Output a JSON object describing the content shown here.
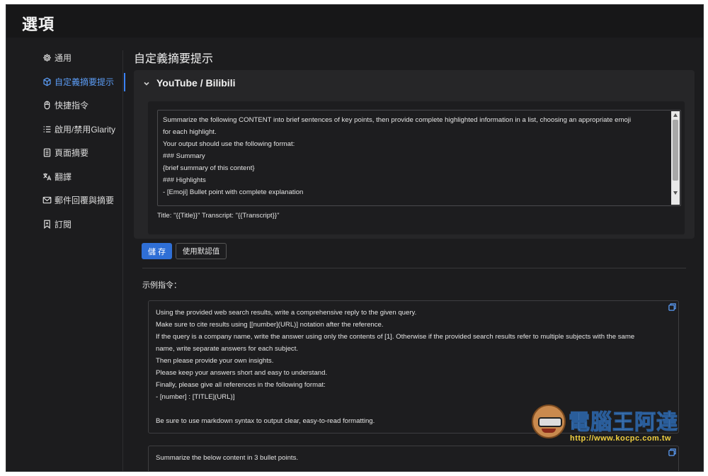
{
  "header": {
    "title": "選項"
  },
  "sidebar": {
    "items": [
      {
        "label": "通用",
        "icon": "gear-icon"
      },
      {
        "label": "自定義摘要提示",
        "icon": "cube-icon",
        "active": true
      },
      {
        "label": "快捷指令",
        "icon": "mouse-icon"
      },
      {
        "label": "啟用/禁用Glarity",
        "icon": "list-toggle-icon"
      },
      {
        "label": "頁面摘要",
        "icon": "document-icon"
      },
      {
        "label": "翻譯",
        "icon": "translate-icon"
      },
      {
        "label": "郵件回覆與摘要",
        "icon": "mail-icon"
      },
      {
        "label": "訂閱",
        "icon": "bookmark-icon"
      }
    ]
  },
  "main": {
    "section_title": "自定義摘要提示",
    "card": {
      "header": "YouTube / Bilibili",
      "prompt_lines": [
        "Summarize the following CONTENT into brief sentences of key points, then provide complete highlighted information in a list, choosing an appropriate emoji",
        "for each highlight.",
        "Your output should use the following format:",
        "### Summary",
        "{brief summary of this content}",
        "### Highlights",
        "- [Emoji] Bullet point with complete explanation"
      ],
      "tail_line": "Title: \"{{Title}}\" Transcript: \"{{Transcript}}\""
    },
    "buttons": {
      "save": "儲 存",
      "default": "使用默認值"
    },
    "examples_label": "示例指令：",
    "examples": [
      {
        "lines": [
          "Using the provided web search results, write a comprehensive reply to the given query.",
          "Make sure to cite results using [[number](URL)] notation after the reference.",
          "If the query is a company name, write the answer using only the contents of [1]. Otherwise if the provided search results refer to multiple subjects with the same",
          "name, write separate answers for each subject.",
          "Then please provide your own insights.",
          "Please keep your answers short and easy to understand.",
          "Finally, please give all references in the following format:",
          "- [number] : [TITLE](URL)]",
          "",
          "Be sure to use markdown syntax to output clear, easy-to-read formatting."
        ]
      },
      {
        "lines": [
          "Summarize the below content in 3 bullet points."
        ]
      }
    ]
  },
  "watermark": {
    "title": "電腦王阿達",
    "url": "http://www.kocpc.com.tw"
  },
  "colors": {
    "accent": "#3b82f6",
    "background": "#1c1c1e",
    "card": "#262628"
  }
}
